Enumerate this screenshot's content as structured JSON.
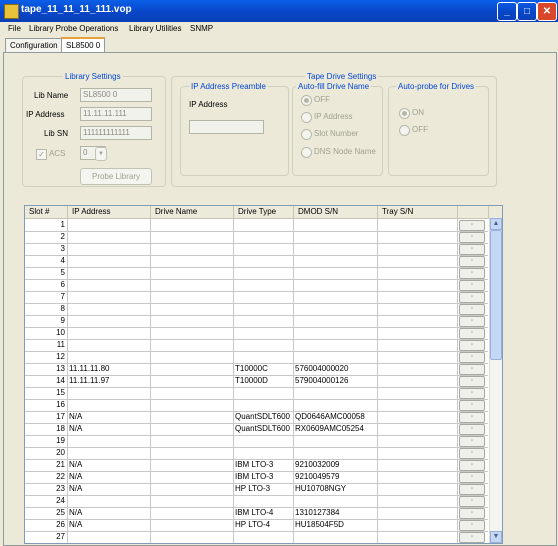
{
  "window": {
    "title": "tape_11_11_11_111.vop"
  },
  "window_controls": {
    "minimize": "_",
    "maximize": "□",
    "close": "✕"
  },
  "menu": {
    "file": "File",
    "probe": "Library Probe Operations",
    "utilities": "Library Utilities",
    "snmp": "SNMP"
  },
  "tabs": {
    "configuration": "Configuration",
    "library": "SL8500 0"
  },
  "library_settings": {
    "title": "Library Settings",
    "lib_name_label": "Lib Name",
    "lib_name_value": "SL8500 0",
    "ip_label": "IP Address",
    "ip_value": "11.11.11.111",
    "lib_sn_label": "Lib SN",
    "lib_sn_value": "111111111111",
    "acs_label": "ACS",
    "acs_value": "0",
    "probe_button": "Probe Library"
  },
  "tape_drive_settings": {
    "title": "Tape Drive Settings",
    "preamble_title": "IP Address Preamble",
    "preamble_ip_label": "IP Address",
    "autofill_title": "Auto-fill Drive Name",
    "autofill_options": [
      "OFF",
      "IP Address",
      "Slot Number",
      "DNS Node Name"
    ],
    "autoprobe_title": "Auto-probe for Drives",
    "autoprobe_options": [
      "ON",
      "OFF"
    ]
  },
  "table": {
    "headers": [
      "Slot #",
      "IP Address",
      "Drive Name",
      "Drive Type",
      "DMOD S/N",
      "Tray S/N"
    ],
    "rows": [
      {
        "slot": "1",
        "ip": "",
        "name": "",
        "type": "",
        "dmod": "",
        "tray": ""
      },
      {
        "slot": "2",
        "ip": "",
        "name": "",
        "type": "",
        "dmod": "",
        "tray": ""
      },
      {
        "slot": "3",
        "ip": "",
        "name": "",
        "type": "",
        "dmod": "",
        "tray": ""
      },
      {
        "slot": "4",
        "ip": "",
        "name": "",
        "type": "",
        "dmod": "",
        "tray": ""
      },
      {
        "slot": "5",
        "ip": "",
        "name": "",
        "type": "",
        "dmod": "",
        "tray": ""
      },
      {
        "slot": "6",
        "ip": "",
        "name": "",
        "type": "",
        "dmod": "",
        "tray": ""
      },
      {
        "slot": "7",
        "ip": "",
        "name": "",
        "type": "",
        "dmod": "",
        "tray": ""
      },
      {
        "slot": "8",
        "ip": "",
        "name": "",
        "type": "",
        "dmod": "",
        "tray": ""
      },
      {
        "slot": "9",
        "ip": "",
        "name": "",
        "type": "",
        "dmod": "",
        "tray": ""
      },
      {
        "slot": "10",
        "ip": "",
        "name": "",
        "type": "",
        "dmod": "",
        "tray": ""
      },
      {
        "slot": "11",
        "ip": "",
        "name": "",
        "type": "",
        "dmod": "",
        "tray": ""
      },
      {
        "slot": "12",
        "ip": "",
        "name": "",
        "type": "",
        "dmod": "",
        "tray": ""
      },
      {
        "slot": "13",
        "ip": "11.11.11.80",
        "name": "",
        "type": "T10000C",
        "dmod": "576004000020",
        "tray": ""
      },
      {
        "slot": "14",
        "ip": "11.11.11.97",
        "name": "",
        "type": "T10000D",
        "dmod": "579004000126",
        "tray": ""
      },
      {
        "slot": "15",
        "ip": "",
        "name": "",
        "type": "",
        "dmod": "",
        "tray": ""
      },
      {
        "slot": "16",
        "ip": "",
        "name": "",
        "type": "",
        "dmod": "",
        "tray": ""
      },
      {
        "slot": "17",
        "ip": "N/A",
        "name": "",
        "type": "QuantSDLT600",
        "dmod": "QD0646AMC00058",
        "tray": ""
      },
      {
        "slot": "18",
        "ip": "N/A",
        "name": "",
        "type": "QuantSDLT600",
        "dmod": "RX0609AMC05254",
        "tray": ""
      },
      {
        "slot": "19",
        "ip": "",
        "name": "",
        "type": "",
        "dmod": "",
        "tray": ""
      },
      {
        "slot": "20",
        "ip": "",
        "name": "",
        "type": "",
        "dmod": "",
        "tray": ""
      },
      {
        "slot": "21",
        "ip": "N/A",
        "name": "",
        "type": "IBM LTO-3",
        "dmod": "9210032009",
        "tray": ""
      },
      {
        "slot": "22",
        "ip": "N/A",
        "name": "",
        "type": "IBM LTO-3",
        "dmod": "9210049579",
        "tray": ""
      },
      {
        "slot": "23",
        "ip": "N/A",
        "name": "",
        "type": "HP LTO-3",
        "dmod": "HU10708NGY",
        "tray": ""
      },
      {
        "slot": "24",
        "ip": "",
        "name": "",
        "type": "",
        "dmod": "",
        "tray": ""
      },
      {
        "slot": "25",
        "ip": "N/A",
        "name": "",
        "type": "IBM LTO-4",
        "dmod": "1310127384",
        "tray": ""
      },
      {
        "slot": "26",
        "ip": "N/A",
        "name": "",
        "type": "HP LTO-4",
        "dmod": "HU18504F5D",
        "tray": ""
      },
      {
        "slot": "27",
        "ip": "",
        "name": "",
        "type": "",
        "dmod": "",
        "tray": ""
      }
    ]
  }
}
